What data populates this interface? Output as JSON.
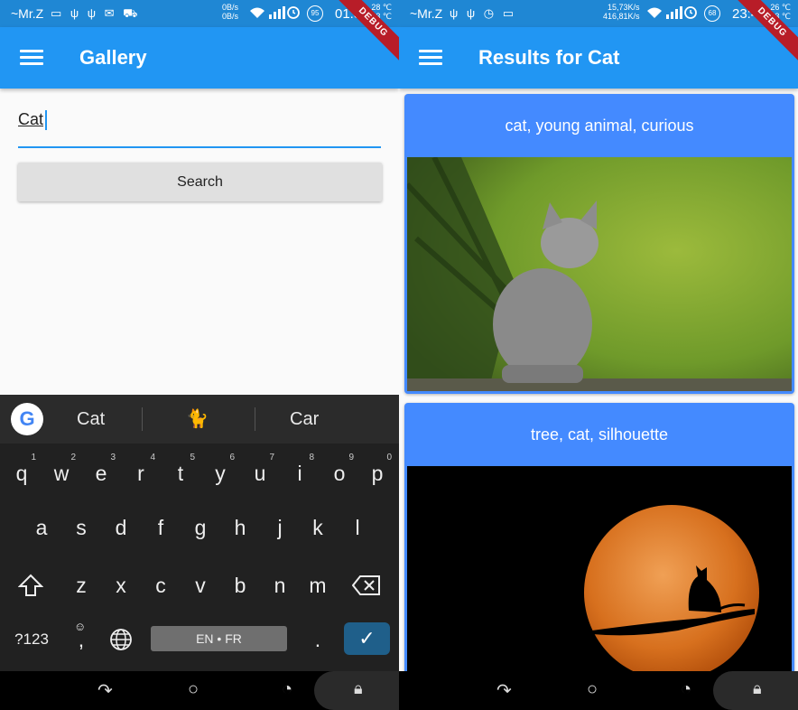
{
  "left": {
    "status": {
      "carrier": "~Mr.Z",
      "icons": "▭ ψ ψ ✉ ⛟",
      "speed_up": "0B/s",
      "speed_down": "0B/s",
      "battery": "95",
      "time": "01:3",
      "temp_top": "28 ℃",
      "temp_bottom": "33 ℃"
    },
    "debug_label": "DEBUG",
    "appbar_title": "Gallery",
    "search_value": "Cat",
    "search_button": "Search",
    "keyboard": {
      "suggestions": [
        "Cat",
        "Car"
      ],
      "suggestion_emoji": "🐈",
      "row1": [
        "q",
        "w",
        "e",
        "r",
        "t",
        "y",
        "u",
        "i",
        "o",
        "p"
      ],
      "row1_hints": [
        "1",
        "2",
        "3",
        "4",
        "5",
        "6",
        "7",
        "8",
        "9",
        "0"
      ],
      "row2": [
        "a",
        "s",
        "d",
        "f",
        "g",
        "h",
        "j",
        "k",
        "l"
      ],
      "row3": [
        "z",
        "x",
        "c",
        "v",
        "b",
        "n",
        "m"
      ],
      "symbols_key": "?123",
      "emoji_comma": ",",
      "space_label": "EN • FR",
      "period": "."
    }
  },
  "right": {
    "status": {
      "carrier": "~Mr.Z",
      "icons": "ψ ψ ◷ ▭",
      "speed_up": "15,73K/s",
      "speed_down": "416,81K/s",
      "battery": "68",
      "time": "23:4",
      "temp_top": "26 ℃",
      "temp_bottom": "33 ℃"
    },
    "debug_label": "DEBUG",
    "appbar_title": "Results for Cat",
    "results": [
      {
        "caption": "cat, young animal, curious"
      },
      {
        "caption": "tree, cat, silhouette"
      }
    ]
  },
  "colors": {
    "appbar": "#2196f3",
    "statusbar": "#1f87d4",
    "card": "#448aff",
    "keyboard_bg": "#212121"
  }
}
